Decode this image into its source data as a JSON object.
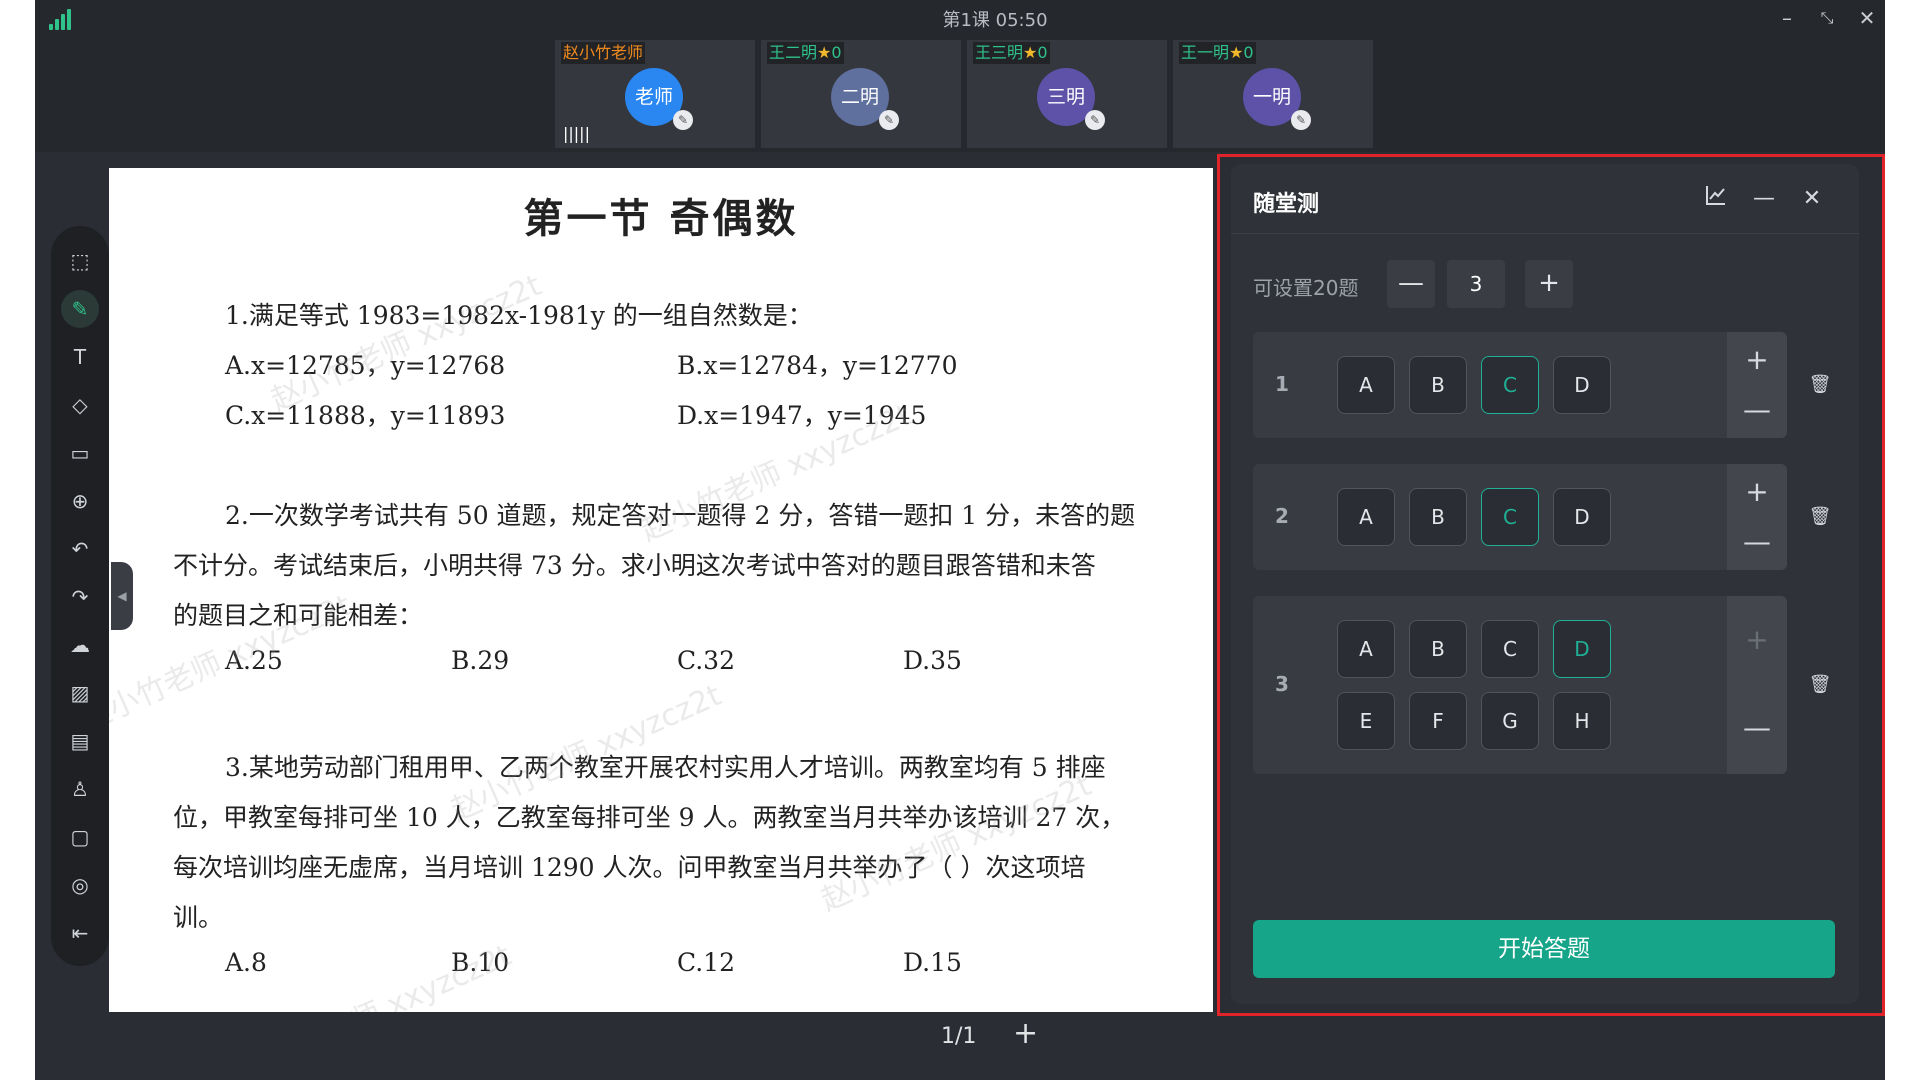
{
  "window": {
    "title": "第1课  05:50",
    "minimize": "–",
    "restore": "⤡",
    "close": "✕"
  },
  "participants": [
    {
      "name": "赵小竹老师",
      "avatar": "老师",
      "color": "#f08a1c",
      "avatar_bg": "#2a86f0"
    },
    {
      "name": "王二明",
      "stars": "0",
      "avatar": "二明",
      "color": "#2fc28a",
      "avatar_bg": "#5f6f9e"
    },
    {
      "name": "王三明",
      "stars": "0",
      "avatar": "三明",
      "color": "#2fc28a",
      "avatar_bg": "#5d52a8"
    },
    {
      "name": "王一明",
      "stars": "0",
      "avatar": "一明",
      "color": "#2fc28a",
      "avatar_bg": "#5d52a8"
    }
  ],
  "toolbar_icons": [
    "select-icon",
    "pen-icon",
    "text-icon",
    "eraser-icon",
    "shape-icon",
    "laser-icon",
    "undo-icon",
    "redo-icon",
    "cloud-upload-icon",
    "image-icon",
    "toolbox-icon",
    "user-icon",
    "chat-icon",
    "settings-icon",
    "exit-icon"
  ],
  "document": {
    "title": "第一节  奇偶数",
    "lines": [
      "1.满足等式 1983=1982x-1981y 的一组自然数是：",
      "A.x=12785，y=12768",
      "B.x=12784，y=12770",
      "C.x=11888，y=11893",
      "D.x=1947，y=1945",
      "2.一次数学考试共有 50 道题，规定答对一题得 2 分，答错一题扣 1 分，未答的题",
      "不计分。考试结束后，小明共得 73 分。求小明这次考试中答对的题目跟答错和未答",
      "的题目之和可能相差：",
      "A.25",
      "B.29",
      "C.32",
      "D.35",
      "3.某地劳动部门租用甲、乙两个教室开展农村实用人才培训。两教室均有 5 排座",
      "位，甲教室每排可坐 10 人，乙教室每排可坐 9 人。两教室当月共举办该培训 27 次，",
      "每次培训均座无虚席，当月培训 1290 人次。问甲教室当月共举办了（      ）次这项培",
      "训。",
      "A.8",
      "B.10",
      "C.12",
      "D.15"
    ],
    "watermark": "赵小竹老师 xxyzcz2t"
  },
  "pager": {
    "text": "1/1",
    "add": "+"
  },
  "quiz": {
    "title": "随堂测",
    "count_label": "可设置20题",
    "count_value": "3",
    "minus": "—",
    "plus": "+",
    "start_label": "开始答题",
    "questions": [
      {
        "num": "1",
        "options": [
          "A",
          "B",
          "C",
          "D"
        ],
        "selected": "C"
      },
      {
        "num": "2",
        "options": [
          "A",
          "B",
          "C",
          "D"
        ],
        "selected": "C"
      },
      {
        "num": "3",
        "options": [
          "A",
          "B",
          "C",
          "D",
          "E",
          "F",
          "G",
          "H"
        ],
        "selected": "D"
      }
    ]
  },
  "colors": {
    "accent": "#17a58a",
    "selected": "#1fb095",
    "highlight": "#e0242a",
    "teacher": "#f08a1c"
  }
}
